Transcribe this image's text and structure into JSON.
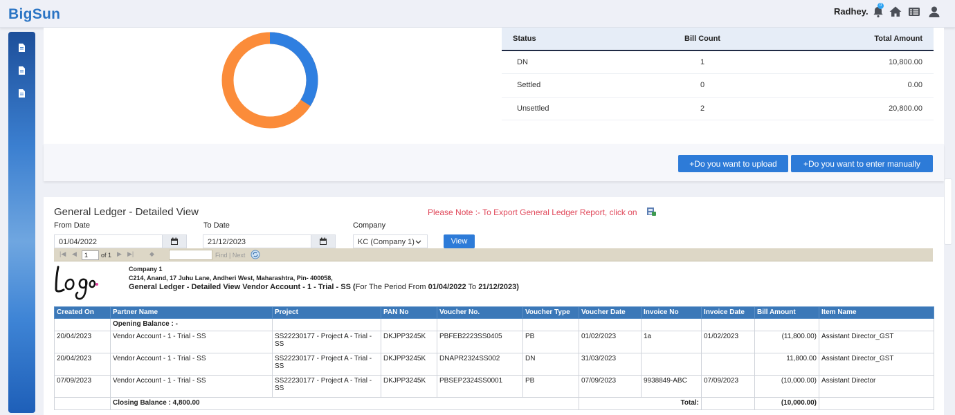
{
  "app": {
    "brand": "BigSun",
    "user_name": "Radhey.",
    "notification_count": "0"
  },
  "status_table": {
    "headers": [
      "Status",
      "Bill Count",
      "Total Amount"
    ],
    "rows": [
      {
        "status": "DN",
        "count": "1",
        "amount": "10,800.00"
      },
      {
        "status": "Settled",
        "count": "0",
        "amount": "0.00"
      },
      {
        "status": "Unsettled",
        "count": "2",
        "amount": "20,800.00"
      }
    ]
  },
  "donut": {
    "colors": {
      "orange": "#fb8c3a",
      "blue": "#2f7fe0"
    },
    "blue_fraction": 0.34
  },
  "actions": {
    "upload_label": "+Do you want to upload",
    "manual_label": "+Do you want to enter manually"
  },
  "ledger": {
    "title": "General Ledger - Detailed View",
    "note": "Please Note :- To Export General Ledger Report, click on",
    "from_label": "From Date",
    "from_value": "01/04/2022",
    "to_label": "To Date",
    "to_value": "21/12/2023",
    "company_label": "Company",
    "company_value": "KC (Company 1)",
    "view_label": "View"
  },
  "report_toolbar": {
    "page": "1",
    "of_text": "of 1",
    "find_text": "Find | Next"
  },
  "report": {
    "company": "Company 1",
    "address": "C214, Anand, 17 Juhu Lane, Andheri West, Maharashtra, Pin- 400058,",
    "heading_bold": "General Ledger - Detailed View Vendor Account - 1 - Trial - SS (",
    "heading_period": "For The Period From ",
    "from": "01/04/2022",
    "to_word": " To ",
    "to": "21/12/2023",
    "close_paren": ")",
    "opening_balance": "Opening Balance : -",
    "columns": [
      "Created On",
      "Partner Name",
      "Project",
      "PAN No",
      "Voucher No.",
      "Voucher Type",
      "Voucher Date",
      "Invoice No",
      "Invoice Date",
      "Bill Amount",
      "Item Name"
    ],
    "rows": [
      {
        "created": "20/04/2023",
        "partner": "Vendor Account - 1 - Trial - SS",
        "project": "SS22230177 - Project A - Trial - SS",
        "pan": "DKJPP3245K",
        "voucher_no": "PBFEB2223SS0405",
        "voucher_type": "PB",
        "voucher_date": "01/02/2023",
        "invoice_no": "1a",
        "invoice_date": "01/02/2023",
        "amount": "(11,800.00)",
        "item": "Assistant Director_GST"
      },
      {
        "created": "20/04/2023",
        "partner": "Vendor Account - 1 - Trial - SS",
        "project": "SS22230177 - Project A - Trial - SS",
        "pan": "DKJPP3245K",
        "voucher_no": "DNAPR2324SS002",
        "voucher_type": "DN",
        "voucher_date": "31/03/2023",
        "invoice_no": "",
        "invoice_date": "",
        "amount": "11,800.00",
        "item": "Assistant Director_GST"
      },
      {
        "created": "07/09/2023",
        "partner": "Vendor Account - 1 - Trial - SS",
        "project": "SS22230177 - Project A - Trial - SS",
        "pan": "DKJPP3245K",
        "voucher_no": "PBSEP2324SS0001",
        "voucher_type": "PB",
        "voucher_date": "07/09/2023",
        "invoice_no": "9938849-ABC",
        "invoice_date": "07/09/2023",
        "amount": "(10,000.00)",
        "item": "Assistant Director"
      }
    ],
    "closing_balance": "Closing Balance : 4,800.00",
    "total_label": "Total:",
    "total_amount": "(10,000.00)"
  }
}
